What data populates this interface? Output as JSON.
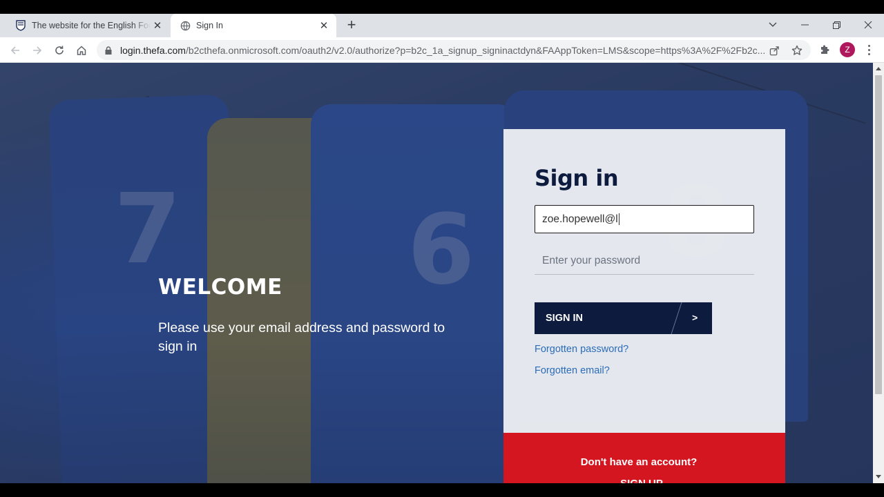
{
  "browser": {
    "tabs": [
      {
        "title": "The website for the English Football Association",
        "icon": "fa-crest-icon"
      },
      {
        "title": "Sign In",
        "icon": "globe-icon"
      }
    ],
    "url_host": "login.thefa.com",
    "url_path": "/b2cthefa.onmicrosoft.com/oauth2/v2.0/authorize?p=b2c_1a_signup_signinactdyn&FAAppToken=LMS&scope=https%3A%2F%2Fb2c...",
    "profile_initial": "Z",
    "profile_color": "#b0185e"
  },
  "page": {
    "welcome_title": "WELCOME",
    "welcome_subtitle": "Please use your email address and password to sign in",
    "jersey_numbers": [
      "7",
      "6",
      "8"
    ]
  },
  "signin": {
    "title": "Sign in",
    "email_value": "zoe.hopewell@l",
    "password_placeholder": "Enter your password",
    "button_label": "SIGN IN",
    "button_arrow": ">",
    "forgot_password": "Forgotten password?",
    "forgot_email": "Forgotten email?"
  },
  "signup": {
    "question": "Don't have an account?",
    "link_label": "SIGN UP"
  },
  "colors": {
    "navy": "#0d1b3e",
    "red": "#d41620",
    "link": "#2b6cb8"
  }
}
